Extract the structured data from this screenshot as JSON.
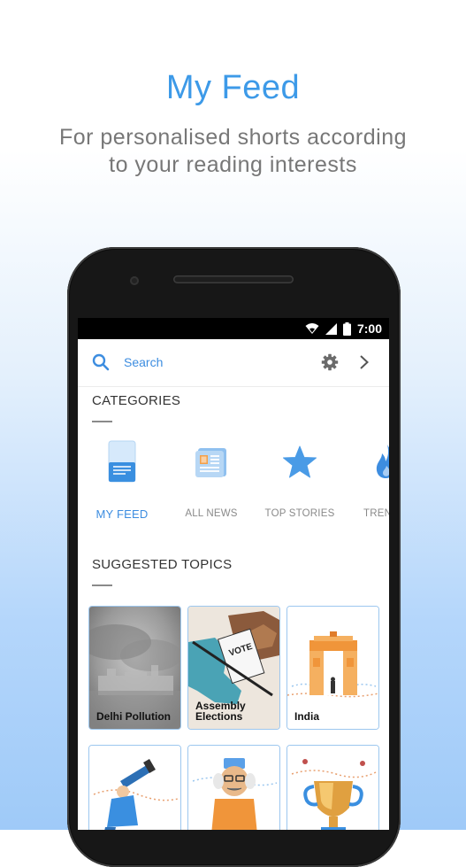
{
  "promo": {
    "title": "My Feed",
    "subtitle": "For personalised shorts according to your reading interests"
  },
  "status_bar": {
    "time": "7:00"
  },
  "search": {
    "placeholder": "Search"
  },
  "categories": {
    "title": "CATEGORIES",
    "items": [
      {
        "label": "MY FEED",
        "icon": "my-feed-icon",
        "active": true
      },
      {
        "label": "ALL NEWS",
        "icon": "newspaper-icon",
        "active": false
      },
      {
        "label": "TOP STORIES",
        "icon": "star-icon",
        "active": false
      },
      {
        "label": "TREN",
        "icon": "flame-icon",
        "active": false
      }
    ]
  },
  "suggested": {
    "title": "SUGGESTED TOPICS",
    "topics": [
      {
        "label": "Delhi Pollution"
      },
      {
        "label": "Assembly Elections"
      },
      {
        "label": "India"
      },
      {
        "label": ""
      },
      {
        "label": ""
      },
      {
        "label": ""
      }
    ]
  },
  "colors": {
    "accent": "#3d8de0",
    "headline": "#3d9ae8"
  }
}
